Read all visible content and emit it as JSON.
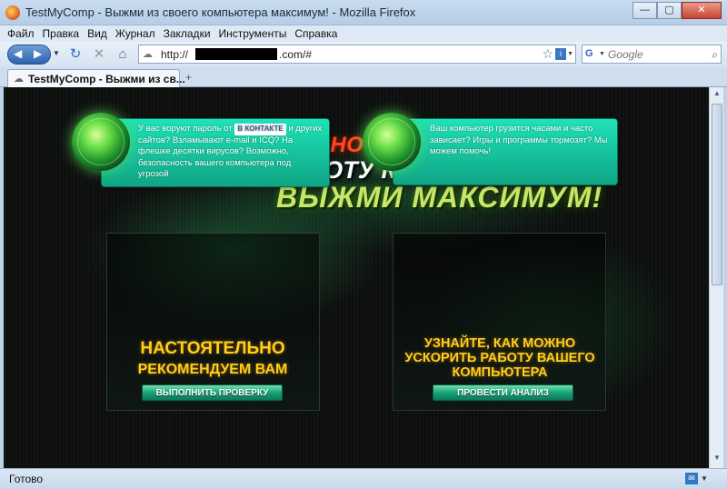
{
  "window": {
    "title": "TestMyComp - Выжми из своего компьютера максимум! - Mozilla Firefox",
    "buttons": {
      "minimize": "—",
      "maximize": "▢",
      "close": "✕"
    }
  },
  "menu": [
    "Файл",
    "Правка",
    "Вид",
    "Журнал",
    "Закладки",
    "Инструменты",
    "Справка"
  ],
  "nav": {
    "back_icon": "back-arrow-icon",
    "forward_icon": "forward-arrow-icon",
    "url_prefix": "http://",
    "url_suffix": ".com/#",
    "search_placeholder": "Google",
    "search_engine_glyph": "G"
  },
  "tab": {
    "label": "TestMyComp - Выжми из св...",
    "new_tab": "+"
  },
  "page": {
    "headline_1": "ПРОВЕРЬ БЕЗОПАСНОСТЬ КОМПЬЮТЕРА",
    "headline_2": "УСКОРЬ РАБОТУ КОМПЬЮТЕРА",
    "headline_3": "ВЫЖМИ МАКСИМУМ!",
    "left": {
      "text_before_badge": "У вас воруют пароль от",
      "badge": "В КОНТАКТЕ",
      "text_after_badge": "и других сайтов? Взламывают e-mail и ICQ? На флешке десятки вирусов? Возможно, безопасность вашего компьютера под угрозой",
      "cta_line_1": "НАСТОЯТЕЛЬНО",
      "cta_line_2": "РЕКОМЕНДУЕМ ВАМ",
      "button": "ВЫПОЛНИТЬ ПРОВЕРКУ"
    },
    "right": {
      "text": "Ваш компьютер грузится часами и часто зависает? Игры и программы тормозят? Мы можем помочь!",
      "cta": "УЗНАЙТЕ, КАК МОЖНО УСКОРИТЬ РАБОТУ ВАШЕГО КОМПЬЮТЕРА",
      "button": "ПРОВЕСТИ АНАЛИЗ"
    }
  },
  "status": {
    "text": "Готово"
  },
  "colors": {
    "accent_red": "#ff4a1f",
    "accent_green": "#c8e66a",
    "cta_yellow": "#ffcf1a",
    "bubble_teal": "#1fe2b8"
  }
}
